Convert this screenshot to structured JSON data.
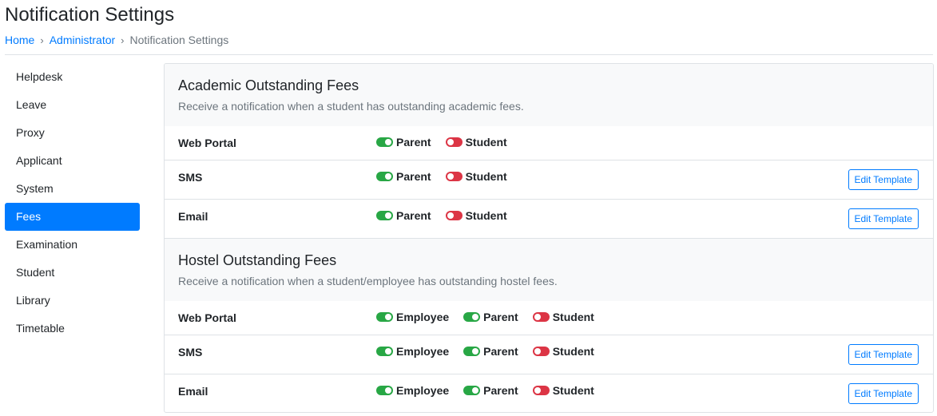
{
  "page": {
    "title": "Notification Settings"
  },
  "breadcrumb": {
    "home": "Home",
    "admin": "Administrator",
    "current": "Notification Settings",
    "separator": "›"
  },
  "sidebar": {
    "items": [
      {
        "label": "Helpdesk",
        "active": false
      },
      {
        "label": "Leave",
        "active": false
      },
      {
        "label": "Proxy",
        "active": false
      },
      {
        "label": "Applicant",
        "active": false
      },
      {
        "label": "System",
        "active": false
      },
      {
        "label": "Fees",
        "active": true
      },
      {
        "label": "Examination",
        "active": false
      },
      {
        "label": "Student",
        "active": false
      },
      {
        "label": "Library",
        "active": false
      },
      {
        "label": "Timetable",
        "active": false
      }
    ]
  },
  "sections": [
    {
      "title": "Academic Outstanding Fees",
      "description": "Receive a notification when a student has outstanding academic fees.",
      "rows": [
        {
          "label": "Web Portal",
          "toggles": [
            {
              "label": "Parent",
              "on": true
            },
            {
              "label": "Student",
              "on": false
            }
          ],
          "edit_label": null
        },
        {
          "label": "SMS",
          "toggles": [
            {
              "label": "Parent",
              "on": true
            },
            {
              "label": "Student",
              "on": false
            }
          ],
          "edit_label": "Edit Template"
        },
        {
          "label": "Email",
          "toggles": [
            {
              "label": "Parent",
              "on": true
            },
            {
              "label": "Student",
              "on": false
            }
          ],
          "edit_label": "Edit Template"
        }
      ]
    },
    {
      "title": "Hostel Outstanding Fees",
      "description": "Receive a notification when a student/employee has outstanding hostel fees.",
      "rows": [
        {
          "label": "Web Portal",
          "toggles": [
            {
              "label": "Employee",
              "on": true
            },
            {
              "label": "Parent",
              "on": true
            },
            {
              "label": "Student",
              "on": false
            }
          ],
          "edit_label": null
        },
        {
          "label": "SMS",
          "toggles": [
            {
              "label": "Employee",
              "on": true
            },
            {
              "label": "Parent",
              "on": true
            },
            {
              "label": "Student",
              "on": false
            }
          ],
          "edit_label": "Edit Template"
        },
        {
          "label": "Email",
          "toggles": [
            {
              "label": "Employee",
              "on": true
            },
            {
              "label": "Parent",
              "on": true
            },
            {
              "label": "Student",
              "on": false
            }
          ],
          "edit_label": "Edit Template"
        }
      ]
    }
  ],
  "colors": {
    "accent": "#007bff",
    "toggle_on": "#28a745",
    "toggle_off": "#dc3545",
    "section_bg": "#f8f9fa",
    "border": "#dee2e6"
  }
}
